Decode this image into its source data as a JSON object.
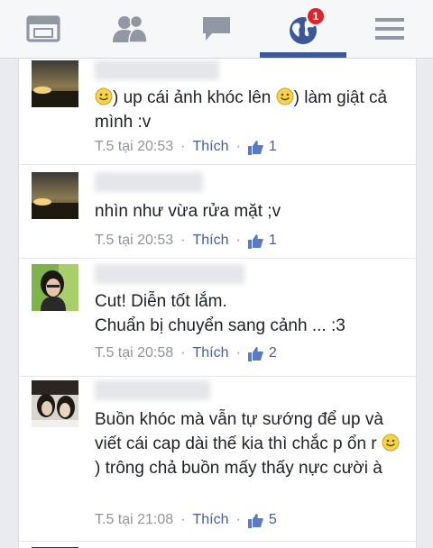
{
  "nav": {
    "badge_count": "1",
    "items": [
      "feed-icon",
      "friends-icon",
      "messages-icon",
      "notifications-globe-icon",
      "menu-icon"
    ]
  },
  "comments": [
    {
      "text_parts": [
        "",
        ") up cái ảnh khóc lên ",
        ") làm giật cả mình :v"
      ],
      "time": "T.5 tại 20:53",
      "like_label": "Thích",
      "likes": "1"
    },
    {
      "text": "nhìn như vừa rửa mặt ;v",
      "time": "T.5 tại 20:53",
      "like_label": "Thích",
      "likes": "1"
    },
    {
      "text_lines": [
        "Cut! Diễn tốt lắm.",
        "Chuẩn bị chuyển sang cảnh ... :3"
      ],
      "time": "T.5 tại 20:58",
      "like_label": "Thích",
      "likes": "2"
    },
    {
      "text_parts": [
        "Buồn khóc mà vẫn tự sướng để up và viết cái cap dài thế kia thì chắc p ổn r ",
        ") trông chả buồn mấy thấy nực cười à"
      ],
      "time": "T.5 tại 21:08",
      "like_label": "Thích",
      "likes": "5"
    }
  ],
  "separator": "·",
  "colors": {
    "brand": "#3b5998",
    "badge": "#e0242d",
    "meta": "#90949c",
    "link": "#4b5f8a"
  }
}
